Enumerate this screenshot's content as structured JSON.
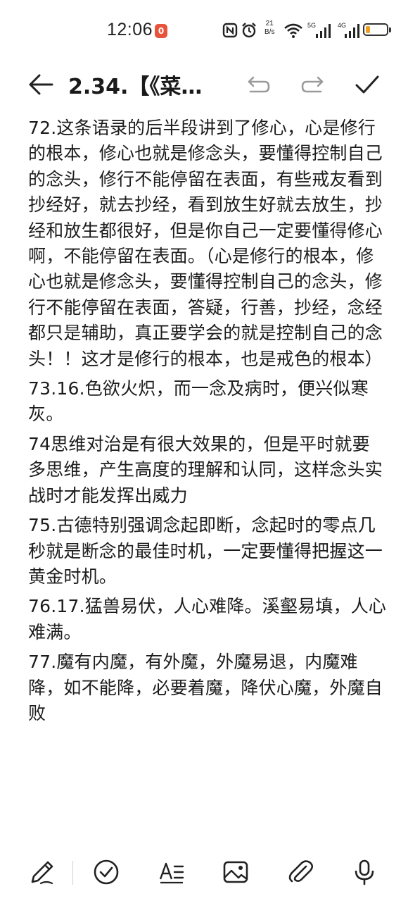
{
  "status_bar": {
    "time": "12:06",
    "notification_badge": "0",
    "net_speed_value": "21",
    "net_speed_unit": "B/s",
    "signal1_label": "5G",
    "signal2_label": "4G",
    "battery_level": 0.2,
    "battery_color": "#f0a020"
  },
  "toolbar": {
    "back_icon": "arrow-left-icon",
    "title": "2.34.【《菜…",
    "undo_icon": "undo-icon",
    "redo_icon": "redo-icon",
    "confirm_icon": "check-icon"
  },
  "content": {
    "paragraphs": [
      "72.这条语录的后半段讲到了修心，心是修行的根本，修心也就是修念头，要懂得控制自己的念头，修行不能停留在表面，有些戒友看到抄经好，就去抄经，看到放生好就去放生，抄经和放生都很好，但是你自己一定要懂得修心啊，不能停留在表面。（心是修行的根本，修心也就是修念头，要懂得控制自己的念头，修行不能停留在表面，答疑，行善，抄经，念经都只是辅助，真正要学会的就是控制自己的念头！！这才是修行的根本，也是戒色的根本）",
      "73.16.色欲火炽，而一念及病时，便兴似寒灰。",
      "74思维对治是有很大效果的，但是平时就要多思维，产生高度的理解和认同，这样念头实战时才能发挥出威力",
      "75.古德特别强调念起即断，念起时的零点几秒就是断念的最佳时机，一定要懂得把握这一黄金时机。",
      "76.17.猛兽易伏，人心难降。溪壑易填，人心难满。",
      "77.魔有内魔，有外魔，外魔易退，内魔难降，如不能降，必要着魔，降伏心魔，外魔自败"
    ]
  },
  "bottom_bar": {
    "icons": [
      "pen-icon",
      "checkbox-icon",
      "text-format-icon",
      "image-icon",
      "attachment-icon",
      "microphone-icon"
    ]
  }
}
